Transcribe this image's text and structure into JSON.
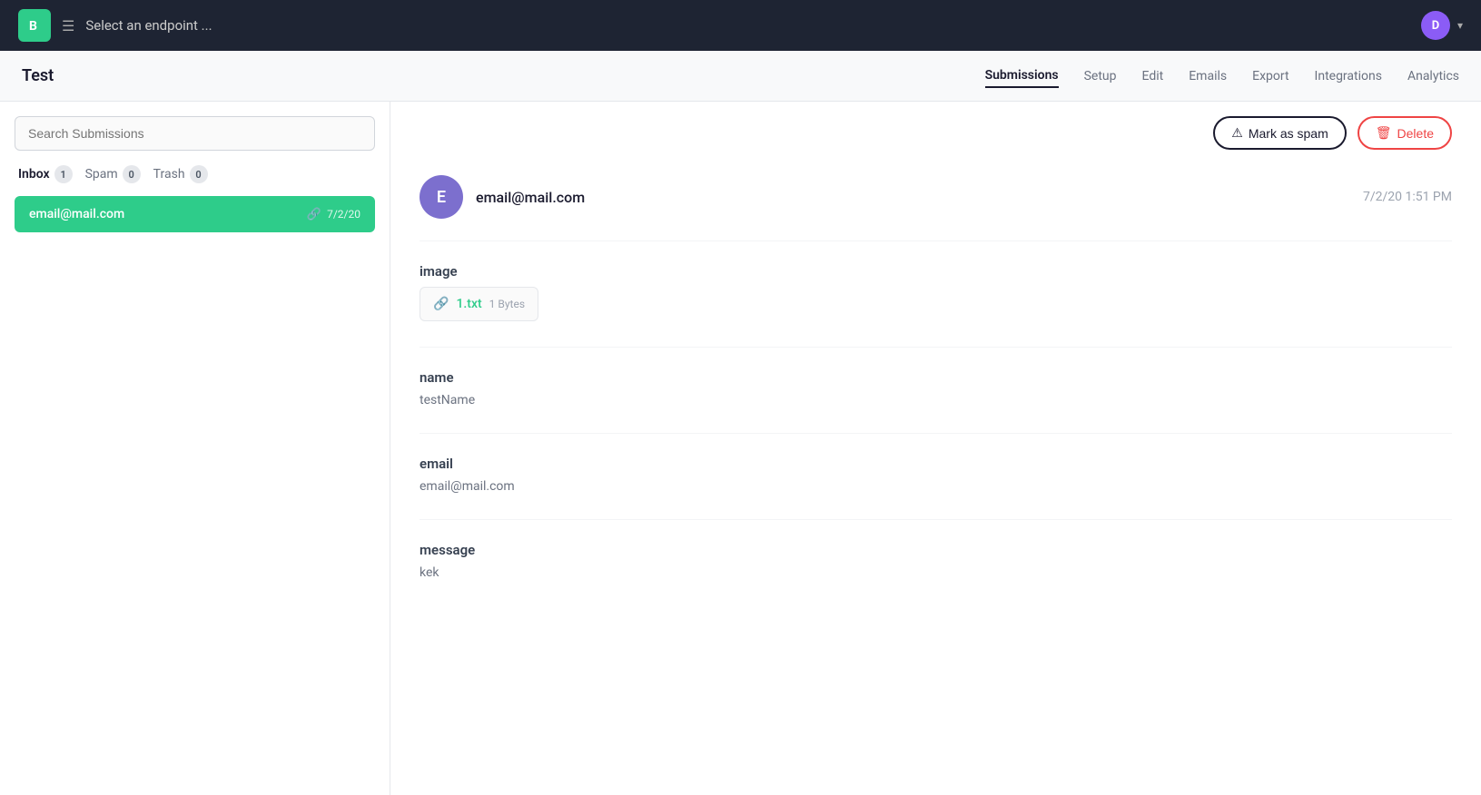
{
  "navbar": {
    "logo_letter": "B",
    "endpoint_label": "Select an endpoint ...",
    "user_initial": "D"
  },
  "secondary_nav": {
    "page_title": "Test",
    "tabs": [
      {
        "id": "submissions",
        "label": "Submissions",
        "active": true
      },
      {
        "id": "setup",
        "label": "Setup",
        "active": false
      },
      {
        "id": "edit",
        "label": "Edit",
        "active": false
      },
      {
        "id": "emails",
        "label": "Emails",
        "active": false
      },
      {
        "id": "export",
        "label": "Export",
        "active": false
      },
      {
        "id": "integrations",
        "label": "Integrations",
        "active": false
      },
      {
        "id": "analytics",
        "label": "Analytics",
        "active": false
      }
    ]
  },
  "left_panel": {
    "search_placeholder": "Search Submissions",
    "filter_tabs": [
      {
        "id": "inbox",
        "label": "Inbox",
        "count": 1,
        "active": true
      },
      {
        "id": "spam",
        "label": "Spam",
        "count": 0,
        "active": false
      },
      {
        "id": "trash",
        "label": "Trash",
        "count": 0,
        "active": false
      }
    ],
    "submissions": [
      {
        "email": "email@mail.com",
        "date": "7/2/20",
        "active": true
      }
    ]
  },
  "right_panel": {
    "mark_as_spam_label": "Mark as spam",
    "delete_label": "Delete",
    "submission": {
      "sender_initial": "E",
      "sender_email": "email@mail.com",
      "timestamp": "7/2/20 1:51 PM",
      "fields": [
        {
          "id": "image",
          "label": "image",
          "type": "file",
          "file_name": "1.txt",
          "file_size": "1 Bytes"
        },
        {
          "id": "name",
          "label": "name",
          "type": "text",
          "value": "testName"
        },
        {
          "id": "email",
          "label": "email",
          "type": "text",
          "value": "email@mail.com"
        },
        {
          "id": "message",
          "label": "message",
          "type": "text",
          "value": "kek"
        }
      ]
    }
  }
}
